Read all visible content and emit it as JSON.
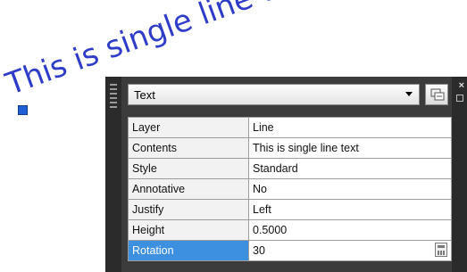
{
  "canvas": {
    "text_object": "This is single line text"
  },
  "palette": {
    "object_type": "Text",
    "close_icon": "close-icon",
    "quick_select_icon": "quick-select-icon",
    "properties": [
      {
        "key": "Layer",
        "value": "Line"
      },
      {
        "key": "Contents",
        "value": "This is single line text"
      },
      {
        "key": "Style",
        "value": "Standard"
      },
      {
        "key": "Annotative",
        "value": "No"
      },
      {
        "key": "Justify",
        "value": "Left"
      },
      {
        "key": "Height",
        "value": "0.5000"
      },
      {
        "key": "Rotation",
        "value": "30"
      }
    ],
    "selected_property": "Rotation",
    "selection_color": "#3d8fe0",
    "text_color": "#2e3cc8"
  }
}
